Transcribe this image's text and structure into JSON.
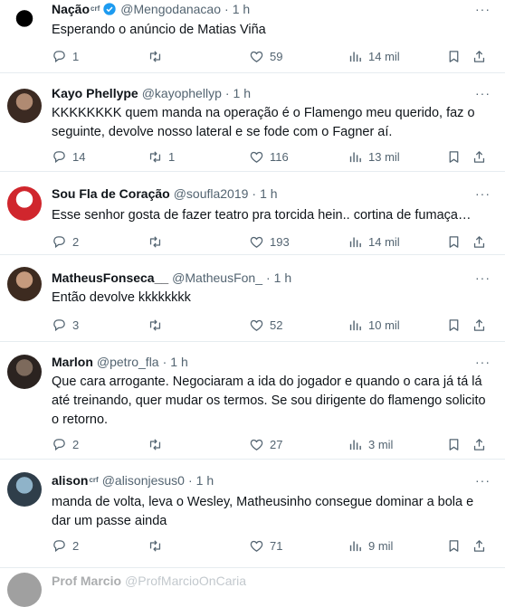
{
  "tweets": [
    {
      "name": "Nação",
      "badge": "crf",
      "verified": true,
      "handle": "@Mengodanacao",
      "time": "1 h",
      "text": "Esperando o anúncio de Matias Viña",
      "replies": "1",
      "retweets": "",
      "likes": "59",
      "views": "14 mil",
      "avatar_colors": [
        "#000000",
        "#ffffff"
      ]
    },
    {
      "name": "Kayo Phellype",
      "badge": "",
      "verified": false,
      "handle": "@kayophellyp",
      "time": "1 h",
      "text": "KKKKKKKK quem manda na operação é o Flamengo meu querido, faz o seguinte, devolve nosso lateral e se fode com o Fagner aí.",
      "replies": "14",
      "retweets": "1",
      "likes": "116",
      "views": "13 mil",
      "avatar_colors": [
        "#b08a72",
        "#3b2a22"
      ]
    },
    {
      "name": "Sou Fla de Coração",
      "badge": "",
      "verified": false,
      "handle": "@soufla2019",
      "time": "1 h",
      "text": "Esse senhor gosta de fazer teatro pra torcida hein.. cortina de fumaça…",
      "replies": "2",
      "retweets": "",
      "likes": "193",
      "views": "14 mil",
      "avatar_colors": [
        "#ffffff",
        "#d0262d"
      ]
    },
    {
      "name": "MatheusFonseca__",
      "badge": "",
      "verified": false,
      "handle": "@MatheusFon_",
      "time": "1 h",
      "text": "Então devolve kkkkkkkk",
      "replies": "3",
      "retweets": "",
      "likes": "52",
      "views": "10 mil",
      "avatar_colors": [
        "#c59a7d",
        "#3d2b20"
      ]
    },
    {
      "name": "Marlon",
      "badge": "",
      "verified": false,
      "handle": "@petro_fla",
      "time": "1 h",
      "text": "Que cara arrogante. Negociaram a ida do jogador e quando o cara já tá lá até treinando, quer mudar os termos. Se sou dirigente do flamengo solicito o retorno.",
      "replies": "2",
      "retweets": "",
      "likes": "27",
      "views": "3 mil",
      "avatar_colors": [
        "#7d6a5c",
        "#2b2320"
      ]
    },
    {
      "name": "alison",
      "badge": "crf",
      "verified": false,
      "handle": "@alisonjesus0",
      "time": "1 h",
      "text": "manda de volta, leva o Wesley, Matheusinho consegue dominar a bola e dar um passe ainda",
      "replies": "2",
      "retweets": "",
      "likes": "71",
      "views": "9 mil",
      "avatar_colors": [
        "#8fb3c9",
        "#2f3e4a"
      ]
    }
  ],
  "partial_tweet": {
    "name": "Prof Marcio",
    "handle": "@ProfMarcioOnCaria"
  },
  "colors": {
    "secondary_text": "#536471",
    "verified_blue": "#1d9bf0",
    "divider": "#e6ecf0"
  },
  "icons": [
    "reply-icon",
    "retweet-icon",
    "like-icon",
    "views-icon",
    "bookmark-icon",
    "share-icon",
    "more-icon",
    "verified-badge-icon"
  ]
}
